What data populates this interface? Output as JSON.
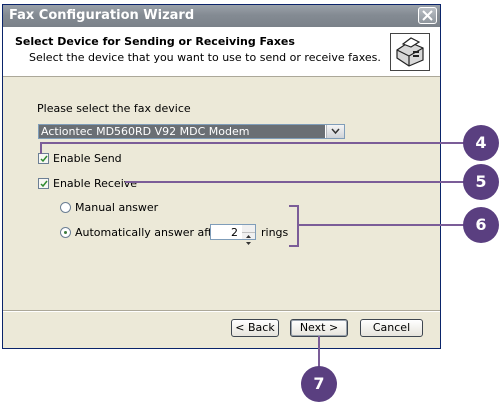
{
  "window": {
    "title": "Fax Configuration Wizard"
  },
  "header": {
    "title": "Select Device for Sending or Receiving Faxes",
    "subtitle": "Select the device that you want to use to send or receive faxes.",
    "icon": "fax-machine-icon"
  },
  "device": {
    "prompt": "Please select the fax device",
    "selected": "Actiontec MD560RD V92 MDC Modem"
  },
  "options": {
    "enable_send": {
      "label": "Enable Send",
      "checked": true
    },
    "enable_receive": {
      "label": "Enable Receive",
      "checked": true
    },
    "manual_answer": {
      "label": "Manual answer",
      "selected": false
    },
    "auto_answer": {
      "label": "Automatically answer after",
      "selected": true
    },
    "rings_value": "2",
    "rings_label": "rings"
  },
  "buttons": {
    "back": "< Back",
    "next": "Next >",
    "cancel": "Cancel"
  },
  "callouts": {
    "c4": "4",
    "c5": "5",
    "c6": "6",
    "c7": "7"
  },
  "colors": {
    "callout": "#5a3f80",
    "callout_line": "#7b5d98",
    "titlebar": "#848b93"
  }
}
